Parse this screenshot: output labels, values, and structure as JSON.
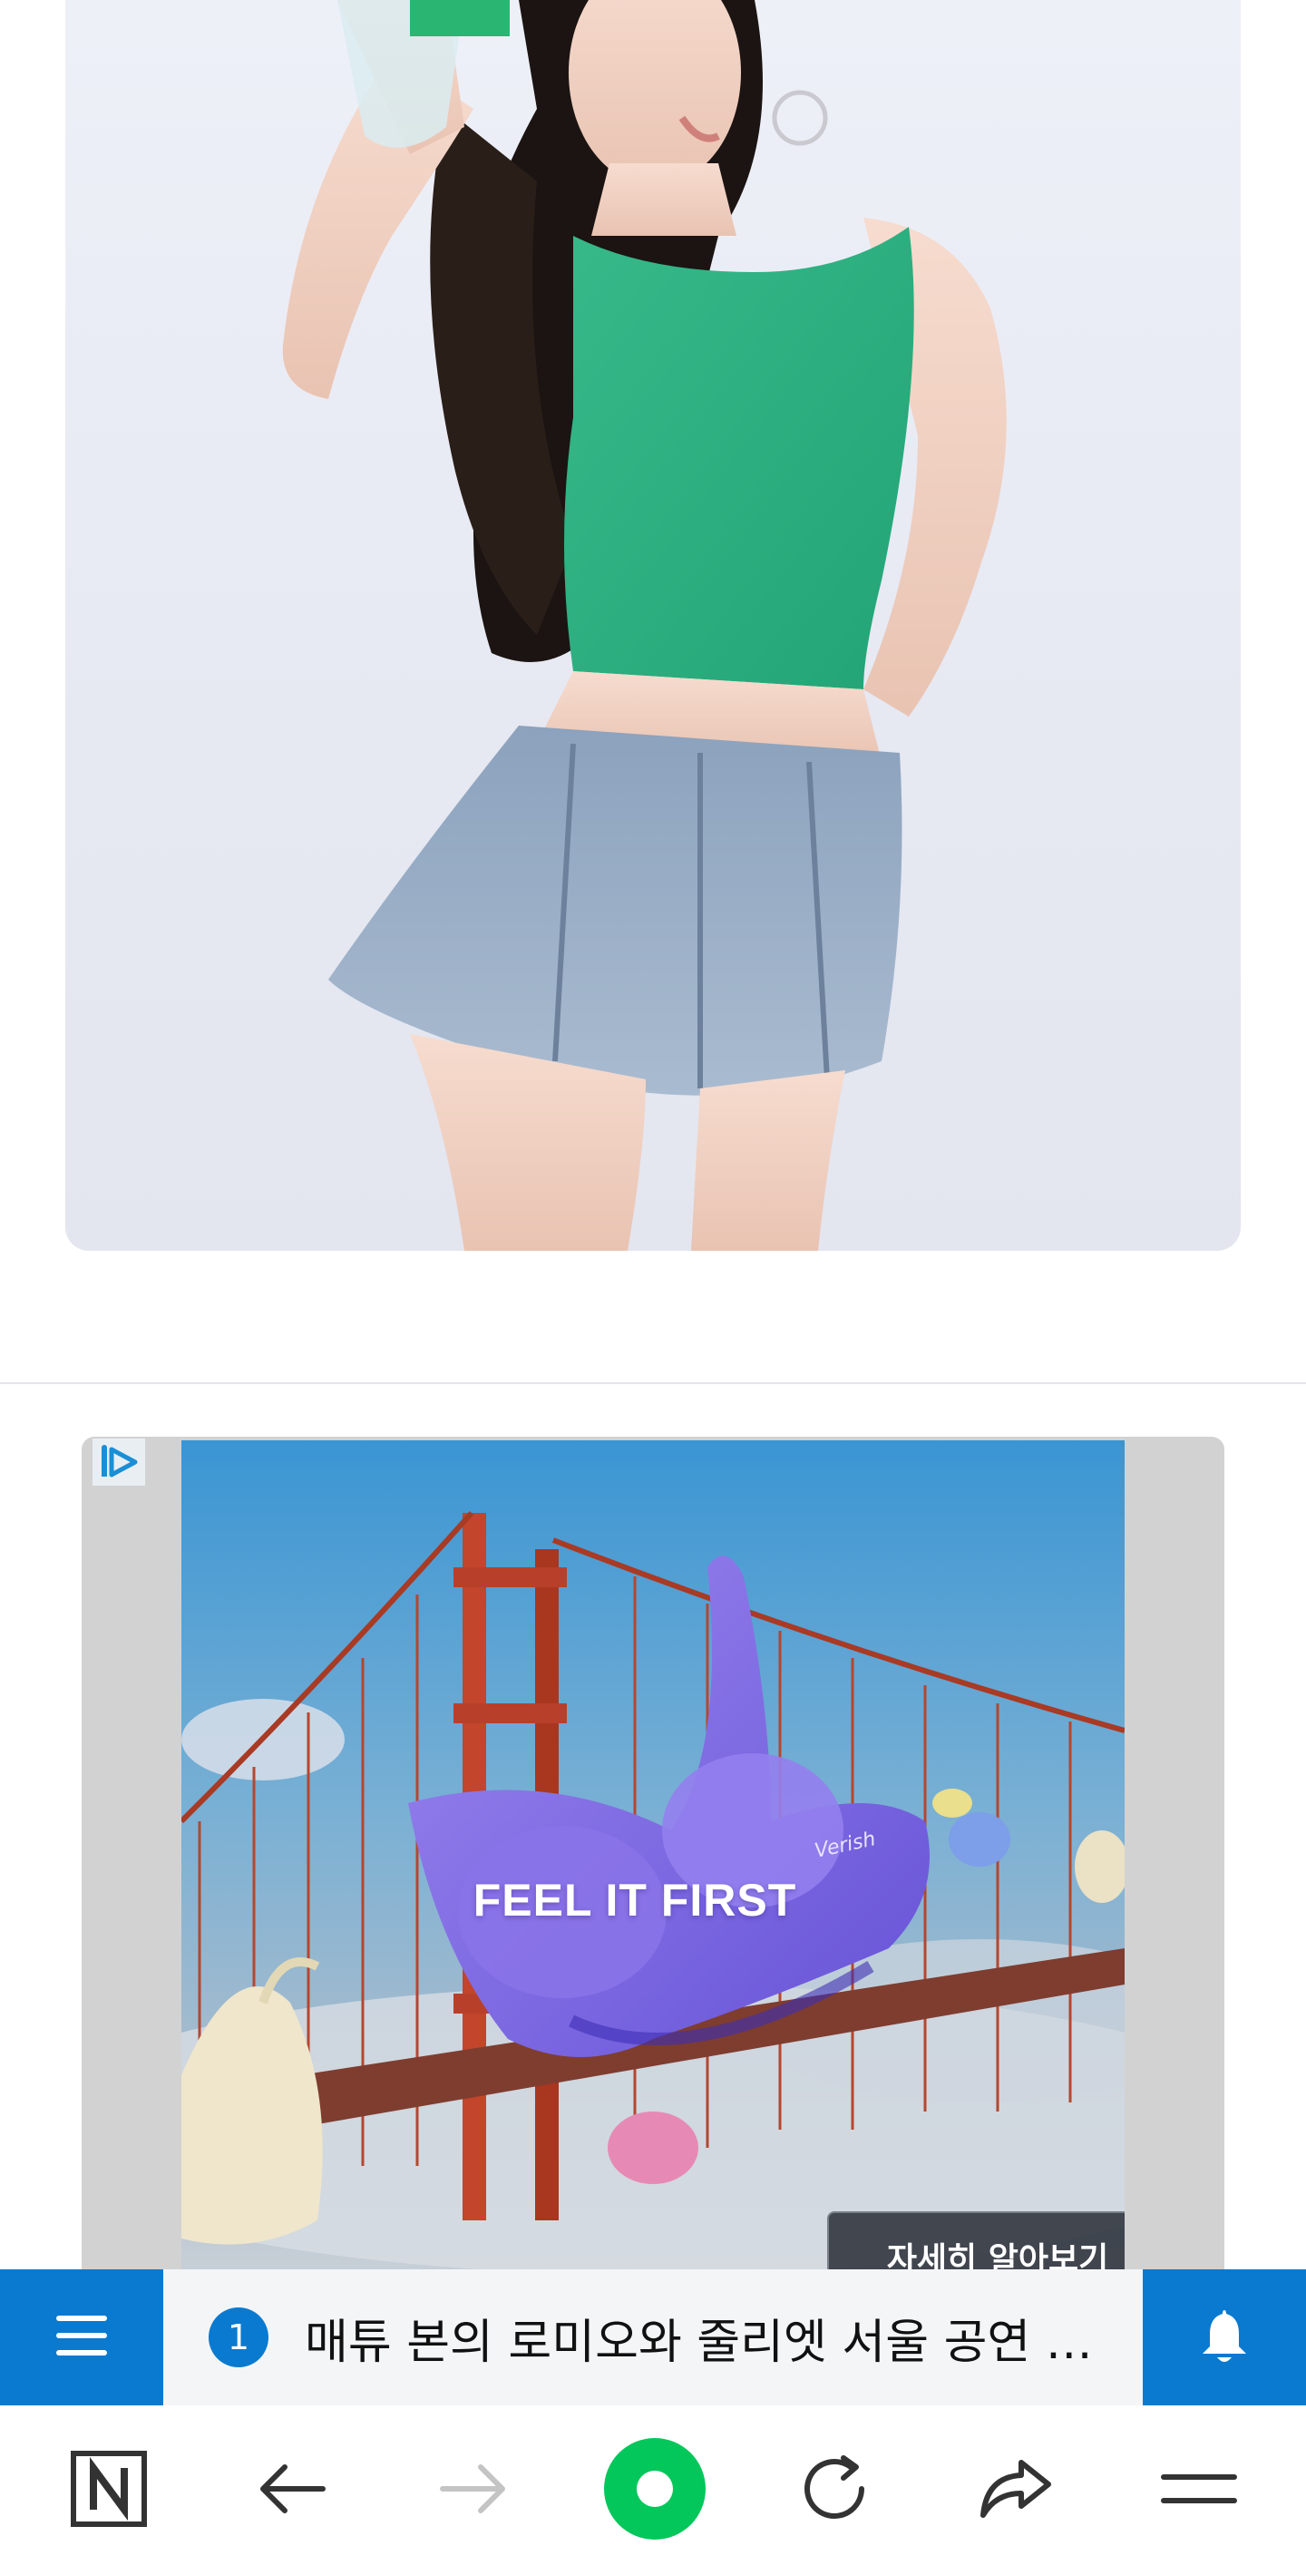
{
  "hero": {
    "image_name": "model-photo-green-top-denim-skirt"
  },
  "ad": {
    "badge_icon": "adchoices-icon",
    "headline": "FEEL IT FIRST",
    "brand_mark": "Verish",
    "cta_label": "자세히 알아보기"
  },
  "ticker": {
    "menu_icon": "hamburger-menu-icon",
    "rank": "1",
    "headline": "매튜 본의 로미오와 줄리엣 서울 공연 확정",
    "bell_icon": "bell-icon",
    "accent_color": "#0a7ad0"
  },
  "toolbar": {
    "items": [
      {
        "name": "naver-home",
        "icon": "n-logo-icon"
      },
      {
        "name": "back",
        "icon": "arrow-left-icon"
      },
      {
        "name": "forward",
        "icon": "arrow-right-icon",
        "disabled": true
      },
      {
        "name": "green-dot",
        "icon": "green-circle-icon",
        "color": "#03c75a"
      },
      {
        "name": "reload",
        "icon": "reload-icon"
      },
      {
        "name": "share",
        "icon": "share-icon"
      },
      {
        "name": "menu",
        "icon": "menu-lines-icon"
      }
    ]
  }
}
